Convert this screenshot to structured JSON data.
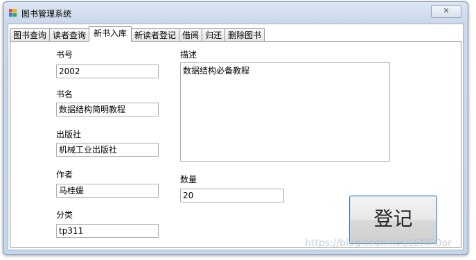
{
  "window": {
    "title": "图书管理系统",
    "close_glyph": "✕"
  },
  "tabs": [
    {
      "label": "图书查询"
    },
    {
      "label": "读者查询"
    },
    {
      "label": "新书入库",
      "active": true
    },
    {
      "label": "新读者登记"
    },
    {
      "label": "借阅"
    },
    {
      "label": "归还"
    },
    {
      "label": "删除图书"
    }
  ],
  "form": {
    "book_no": {
      "label": "书号",
      "value": "2002"
    },
    "book_name": {
      "label": "书名",
      "value": "数据结构简明教程"
    },
    "publisher": {
      "label": "出版社",
      "value": "机械工业出版社"
    },
    "author": {
      "label": "作者",
      "value": "马桂媛"
    },
    "category": {
      "label": "分类",
      "value": "tp311"
    },
    "description": {
      "label": "描述",
      "value": "数据结构必备教程"
    },
    "quantity": {
      "label": "数量",
      "value": "20"
    },
    "register_label": "登记"
  },
  "watermark": "https://blog.csdn.net/LEMFOor",
  "colors": {
    "accent": "#3c7fb1",
    "titlebar": "#cad8ea"
  }
}
